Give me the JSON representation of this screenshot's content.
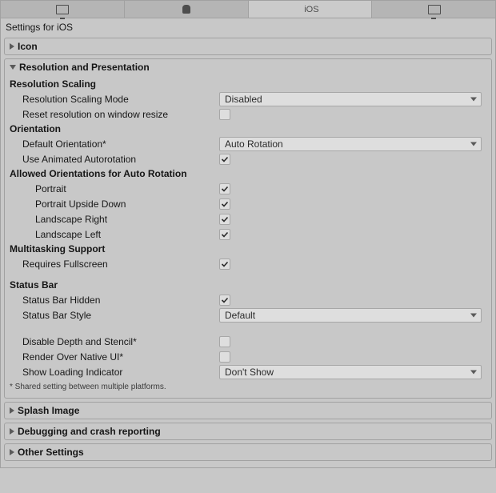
{
  "tabs": {
    "items": [
      {
        "name": "standalone",
        "label": ""
      },
      {
        "name": "android",
        "label": ""
      },
      {
        "name": "ios",
        "label": "iOS"
      },
      {
        "name": "other",
        "label": ""
      }
    ],
    "active": "ios"
  },
  "title": "Settings for iOS",
  "sections": {
    "icon": {
      "title": "Icon",
      "expanded": false
    },
    "resolution": {
      "title": "Resolution and Presentation",
      "expanded": true,
      "groups": {
        "resolution_scaling": {
          "heading": "Resolution Scaling",
          "mode_label": "Resolution Scaling Mode",
          "mode_value": "Disabled",
          "reset_label": "Reset resolution on window resize",
          "reset_checked": false
        },
        "orientation": {
          "heading": "Orientation",
          "default_label": "Default Orientation*",
          "default_value": "Auto Rotation",
          "animated_label": "Use Animated Autorotation",
          "animated_checked": true
        },
        "allowed": {
          "heading": "Allowed Orientations for Auto Rotation",
          "portrait_label": "Portrait",
          "portrait_checked": true,
          "portrait_upside_label": "Portrait Upside Down",
          "portrait_upside_checked": true,
          "landscape_right_label": "Landscape Right",
          "landscape_right_checked": true,
          "landscape_left_label": "Landscape Left",
          "landscape_left_checked": true
        },
        "multitasking": {
          "heading": "Multitasking Support",
          "requires_fullscreen_label": "Requires Fullscreen",
          "requires_fullscreen_checked": true
        },
        "status_bar": {
          "heading": "Status Bar",
          "hidden_label": "Status Bar Hidden",
          "hidden_checked": true,
          "style_label": "Status Bar Style",
          "style_value": "Default",
          "disable_depth_label": "Disable Depth and Stencil*",
          "disable_depth_checked": false,
          "render_over_label": "Render Over Native UI*",
          "render_over_checked": false,
          "loading_label": "Show Loading Indicator",
          "loading_value": "Don't Show"
        }
      },
      "footnote": "* Shared setting between multiple platforms."
    },
    "splash": {
      "title": "Splash Image",
      "expanded": false
    },
    "debugging": {
      "title": "Debugging and crash reporting",
      "expanded": false
    },
    "other": {
      "title": "Other Settings",
      "expanded": false
    }
  }
}
